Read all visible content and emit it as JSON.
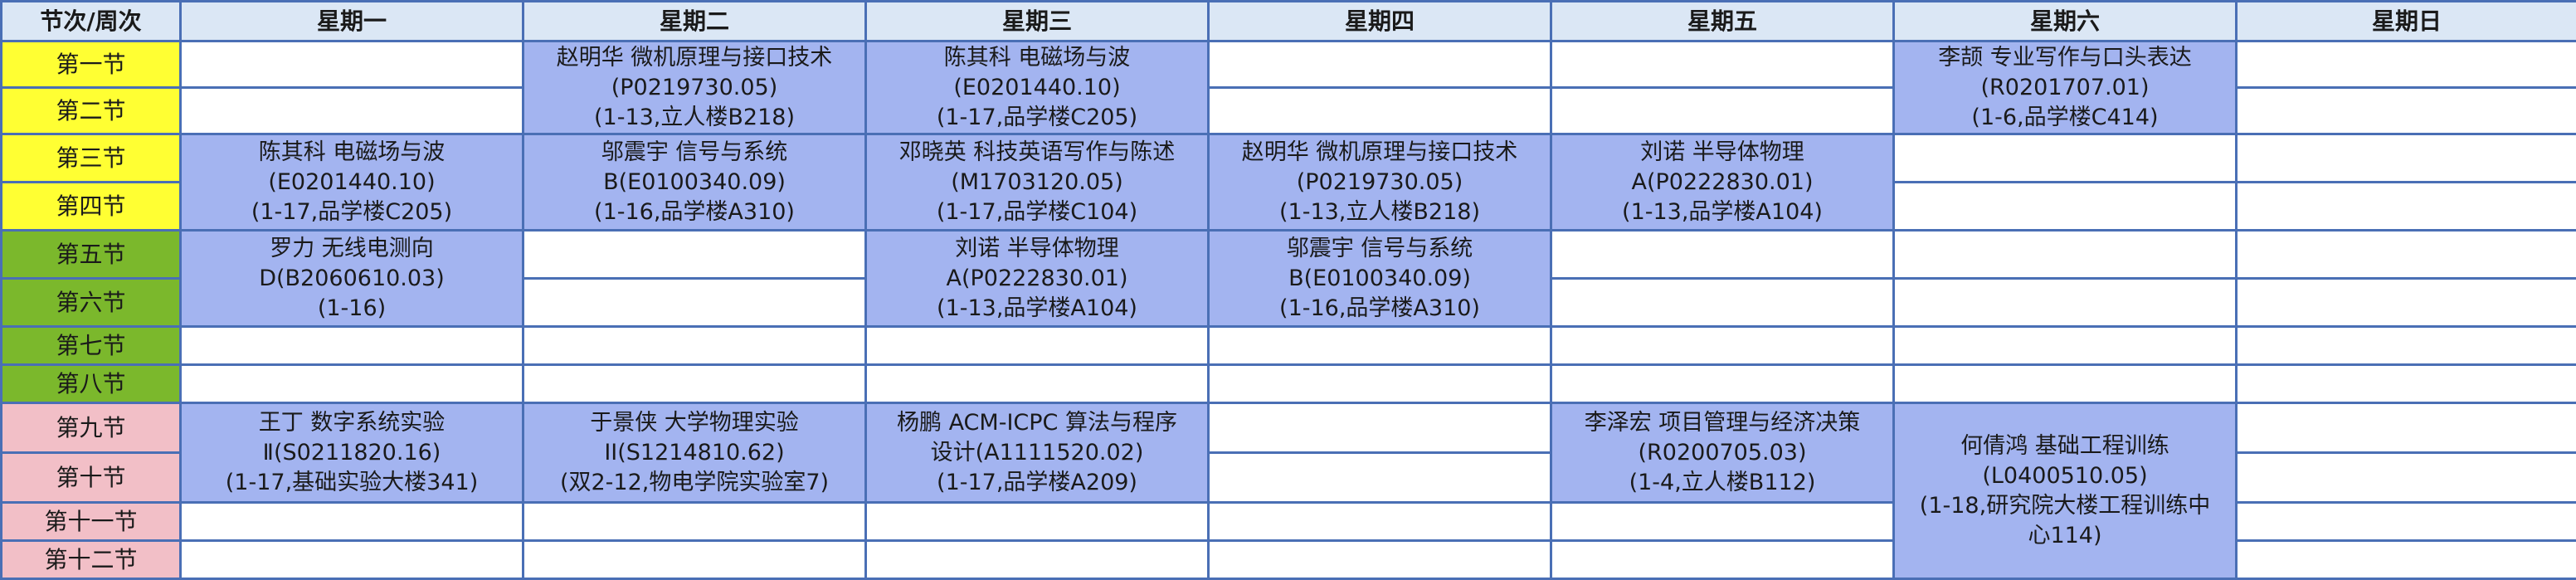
{
  "header": {
    "corner": "节次/周次",
    "days": [
      "星期一",
      "星期二",
      "星期三",
      "星期四",
      "星期五",
      "星期六",
      "星期日"
    ]
  },
  "periods": [
    "第一节",
    "第二节",
    "第三节",
    "第四节",
    "第五节",
    "第六节",
    "第七节",
    "第八节",
    "第九节",
    "第十节",
    "第十一节",
    "第十二节"
  ],
  "colors": {
    "morning": "#ffff33",
    "afternoon": "#7bb82c",
    "evening": "#f2bfc7",
    "course": "#a3b4f0",
    "header": "#dbe7f5",
    "border": "#4a6fb5"
  },
  "courses": {
    "tue_1_2": {
      "line1": "赵明华 微机原理与接口技术",
      "line2": "(P0219730.05)",
      "line3": "(1-13,立人楼B218)"
    },
    "wed_1_2": {
      "line1": "陈其科 电磁场与波",
      "line2": "(E0201440.10)",
      "line3": "(1-17,品学楼C205)"
    },
    "sat_1_2": {
      "line1": "李颉 专业写作与口头表达",
      "line2": "(R0201707.01)",
      "line3": "(1-6,品学楼C414)"
    },
    "mon_3_4": {
      "line1": "陈其科 电磁场与波",
      "line2": "(E0201440.10)",
      "line3": "(1-17,品学楼C205)"
    },
    "tue_3_4": {
      "line1": "邬震宇 信号与系统",
      "line2": "B(E0100340.09)",
      "line3": "(1-16,品学楼A310)"
    },
    "wed_3_4": {
      "line1": "邓晓英 科技英语写作与陈述",
      "line2": "(M1703120.05)",
      "line3": "(1-17,品学楼C104)"
    },
    "thu_3_4": {
      "line1": "赵明华 微机原理与接口技术",
      "line2": "(P0219730.05)",
      "line3": "(1-13,立人楼B218)"
    },
    "fri_3_4": {
      "line1": "刘诺 半导体物理",
      "line2": "A(P0222830.01)",
      "line3": "(1-13,品学楼A104)"
    },
    "mon_5_6": {
      "line1": "罗力 无线电测向",
      "line2": "D(B2060610.03)",
      "line3": "(1-16)"
    },
    "wed_5_6": {
      "line1": "刘诺 半导体物理",
      "line2": "A(P0222830.01)",
      "line3": "(1-13,品学楼A104)"
    },
    "thu_5_6": {
      "line1": "邬震宇 信号与系统",
      "line2": "B(E0100340.09)",
      "line3": "(1-16,品学楼A310)"
    },
    "mon_9_10": {
      "line1": "王丁 数字系统实验",
      "line2": "Ⅱ(S0211820.16)",
      "line3": "(1-17,基础实验大楼341)"
    },
    "tue_9_10": {
      "line1": "于景侠 大学物理实验",
      "line2": "II(S1214810.62)",
      "line3": "(双2-12,物电学院实验室7)"
    },
    "wed_9_10": {
      "line1": "杨鹏 ACM-ICPC 算法与程序",
      "line2": "设计(A1111520.02)",
      "line3": "(1-17,品学楼A209)"
    },
    "fri_9_10": {
      "line1": "李泽宏 项目管理与经济决策",
      "line2": "(R0200705.03)",
      "line3": "(1-4,立人楼B112)"
    },
    "sat_9_12": {
      "line1": "何倩鸿 基础工程训练",
      "line2": "(L0400510.05)",
      "line3": "(1-18,研究院大楼工程训练中",
      "line4": "心114)"
    }
  }
}
